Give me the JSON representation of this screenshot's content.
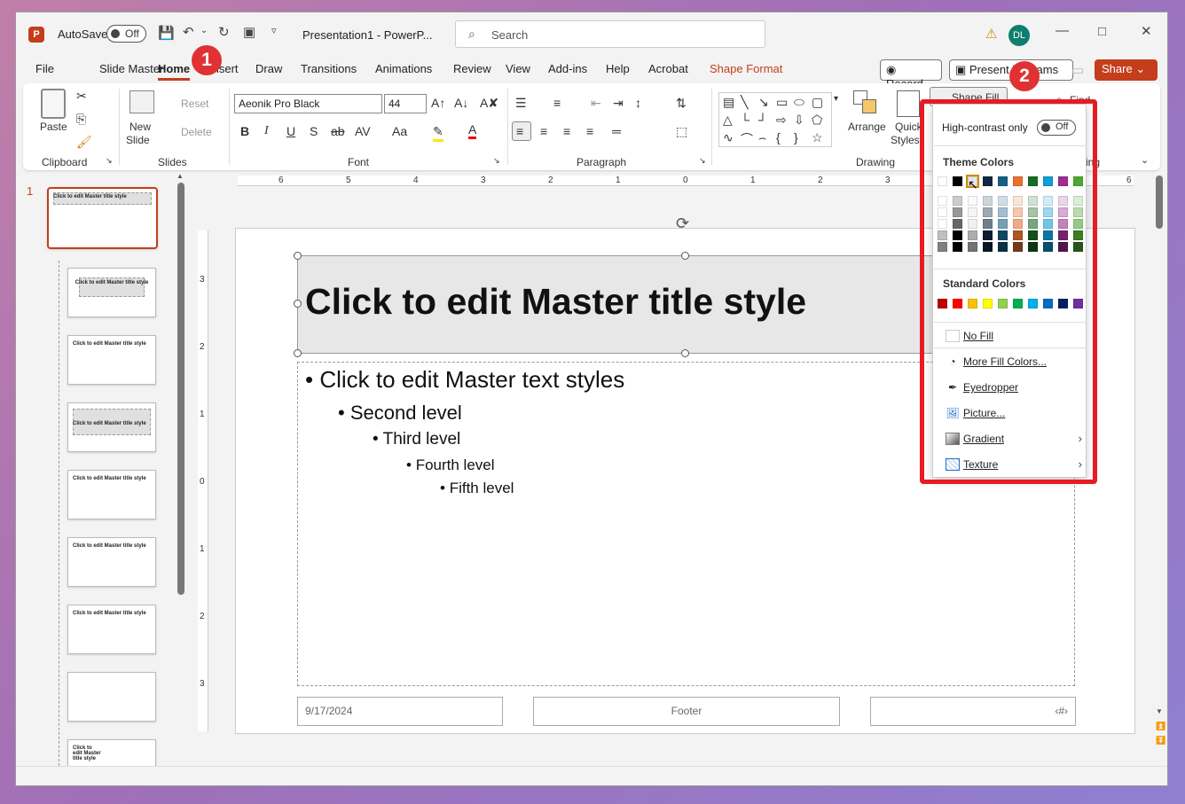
{
  "window": {
    "title": "Presentation1  -  PowerP...",
    "autosave_label": "AutoSave",
    "autosave_state": "Off",
    "user_initials": "DL"
  },
  "search": {
    "placeholder": "Search"
  },
  "menu": {
    "items": [
      "File",
      "Slide Master",
      "Home",
      "Insert",
      "Draw",
      "Transitions",
      "Animations",
      "Review",
      "View",
      "Add-ins",
      "Help",
      "Acrobat",
      "Shape Format"
    ],
    "active": "Home",
    "record_label": "Record",
    "present_label": "Present in Teams",
    "share_label": "Share"
  },
  "ribbon": {
    "clipboard": {
      "paste_label": "Paste",
      "group_label": "Clipboard"
    },
    "slides": {
      "new_slide_label": "New",
      "new_slide_sub": "Slide",
      "reset_label": "Reset",
      "delete_label": "Delete",
      "group_label": "Slides"
    },
    "font": {
      "font_name": "Aeonik Pro Black",
      "font_size": "44",
      "group_label": "Font"
    },
    "paragraph": {
      "group_label": "Paragraph"
    },
    "drawing": {
      "arrange_label": "Arrange",
      "quick_styles_label": "Quick",
      "quick_styles_sub": "Styles",
      "shape_fill_label": "Shape Fill",
      "group_label": "Drawing"
    },
    "editing": {
      "find_label": "Find",
      "partial_label": "ing"
    }
  },
  "ruler": {
    "h_numbers": [
      "6",
      "5",
      "4",
      "3",
      "2",
      "1",
      "0",
      "1",
      "2",
      "3",
      "6"
    ],
    "v_numbers": [
      "3",
      "2",
      "1",
      "0",
      "1",
      "2",
      "3"
    ]
  },
  "slide_panel": {
    "selected_index": "1",
    "thumb_title": "Click to edit Master title style"
  },
  "slide": {
    "title": "Click to edit Master title style",
    "bullets": [
      {
        "text": "Click to edit Master text styles",
        "level": 1
      },
      {
        "text": "Second level",
        "level": 2
      },
      {
        "text": "Third level",
        "level": 3
      },
      {
        "text": "Fourth level",
        "level": 4
      },
      {
        "text": "Fifth level",
        "level": 5
      }
    ],
    "date": "9/17/2024",
    "footer": "Footer",
    "page_number": "‹#›"
  },
  "shape_fill_menu": {
    "high_contrast_label": "High-contrast only",
    "high_contrast_state": "Off",
    "theme_colors_heading": "Theme Colors",
    "theme_colors": [
      "#ffffff",
      "#000000",
      "#e7e6e6",
      "#0e2841",
      "#156082",
      "#e97132",
      "#196b24",
      "#0f9ed5",
      "#a02b93",
      "#4ea72e"
    ],
    "standard_colors_heading": "Standard Colors",
    "standard_colors": [
      "#c00000",
      "#ff0000",
      "#ffc000",
      "#ffff00",
      "#92d050",
      "#00b050",
      "#00b0f0",
      "#0070c0",
      "#002060",
      "#7030a0"
    ],
    "items": [
      {
        "label": "No Fill",
        "icon": "no-fill-icon",
        "submenu": false
      },
      {
        "label": "More Fill Colors...",
        "icon": "palette-icon",
        "submenu": false
      },
      {
        "label": "Eyedropper",
        "icon": "eyedropper-icon",
        "submenu": false
      },
      {
        "label": "Picture...",
        "icon": "picture-icon",
        "submenu": false
      },
      {
        "label": "Gradient",
        "icon": "gradient-icon",
        "submenu": true
      },
      {
        "label": "Texture",
        "icon": "texture-icon",
        "submenu": true
      }
    ]
  },
  "annotations": {
    "step1": "1",
    "step2": "2",
    "highlight_color": "#e81b23"
  },
  "colors": {
    "accent": "#c43e1c"
  }
}
